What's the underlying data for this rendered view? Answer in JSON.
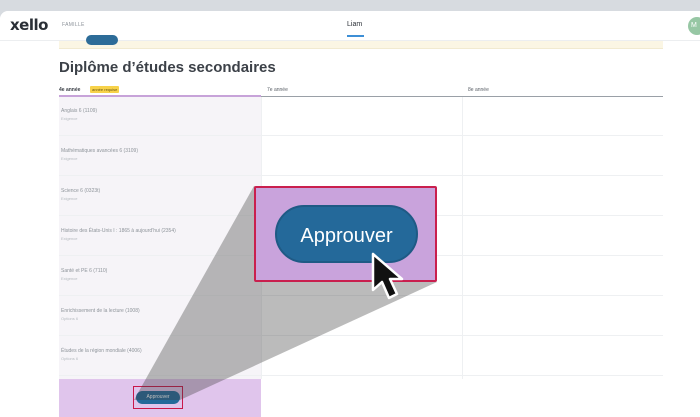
{
  "app": {
    "logo": "xello",
    "logo_sub": "FAMILLE",
    "student_name": "Liam",
    "avatar_initial": "M"
  },
  "page": {
    "title": "Diplôme d’études secondaires"
  },
  "columns": {
    "grade4": "4e année",
    "grade4_badge": "année requise",
    "grade7": "7e année",
    "grade8": "8e année"
  },
  "courses": [
    {
      "name": "Anglais 6 (1109)",
      "status": "Exigence"
    },
    {
      "name": "Mathématiques avancées 6 (3109)",
      "status": "Exigence"
    },
    {
      "name": "Science 6 (0323t)",
      "status": "Exigence"
    },
    {
      "name": "Histoire des États-Unis I : 1865 à aujourd’hui (2354)",
      "status": "Exigence"
    },
    {
      "name": "Santé et PE 6 (7110)",
      "status": "Exigence"
    },
    {
      "name": "Enrichissement de la lecture (1008)",
      "status": "Options 6"
    },
    {
      "name": "Études de la région mondiale (4006)",
      "status": "Options 6"
    }
  ],
  "actions": {
    "approve_small": "Approuver",
    "approve_large": "Approuver"
  },
  "colors": {
    "primary_button": "#24699a",
    "highlight": "#c9a3dc",
    "highlight_border": "#c91f4e",
    "required_badge": "#f7d24a"
  }
}
